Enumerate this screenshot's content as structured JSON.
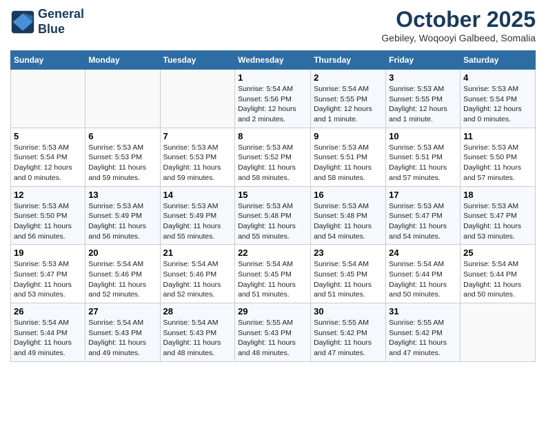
{
  "header": {
    "logo_line1": "General",
    "logo_line2": "Blue",
    "month": "October 2025",
    "location": "Gebiley, Woqooyi Galbeed, Somalia"
  },
  "weekdays": [
    "Sunday",
    "Monday",
    "Tuesday",
    "Wednesday",
    "Thursday",
    "Friday",
    "Saturday"
  ],
  "weeks": [
    [
      {
        "day": "",
        "info": ""
      },
      {
        "day": "",
        "info": ""
      },
      {
        "day": "",
        "info": ""
      },
      {
        "day": "1",
        "info": "Sunrise: 5:54 AM\nSunset: 5:56 PM\nDaylight: 12 hours and 2 minutes."
      },
      {
        "day": "2",
        "info": "Sunrise: 5:54 AM\nSunset: 5:55 PM\nDaylight: 12 hours and 1 minute."
      },
      {
        "day": "3",
        "info": "Sunrise: 5:53 AM\nSunset: 5:55 PM\nDaylight: 12 hours and 1 minute."
      },
      {
        "day": "4",
        "info": "Sunrise: 5:53 AM\nSunset: 5:54 PM\nDaylight: 12 hours and 0 minutes."
      }
    ],
    [
      {
        "day": "5",
        "info": "Sunrise: 5:53 AM\nSunset: 5:54 PM\nDaylight: 12 hours and 0 minutes."
      },
      {
        "day": "6",
        "info": "Sunrise: 5:53 AM\nSunset: 5:53 PM\nDaylight: 11 hours and 59 minutes."
      },
      {
        "day": "7",
        "info": "Sunrise: 5:53 AM\nSunset: 5:53 PM\nDaylight: 11 hours and 59 minutes."
      },
      {
        "day": "8",
        "info": "Sunrise: 5:53 AM\nSunset: 5:52 PM\nDaylight: 11 hours and 58 minutes."
      },
      {
        "day": "9",
        "info": "Sunrise: 5:53 AM\nSunset: 5:51 PM\nDaylight: 11 hours and 58 minutes."
      },
      {
        "day": "10",
        "info": "Sunrise: 5:53 AM\nSunset: 5:51 PM\nDaylight: 11 hours and 57 minutes."
      },
      {
        "day": "11",
        "info": "Sunrise: 5:53 AM\nSunset: 5:50 PM\nDaylight: 11 hours and 57 minutes."
      }
    ],
    [
      {
        "day": "12",
        "info": "Sunrise: 5:53 AM\nSunset: 5:50 PM\nDaylight: 11 hours and 56 minutes."
      },
      {
        "day": "13",
        "info": "Sunrise: 5:53 AM\nSunset: 5:49 PM\nDaylight: 11 hours and 56 minutes."
      },
      {
        "day": "14",
        "info": "Sunrise: 5:53 AM\nSunset: 5:49 PM\nDaylight: 11 hours and 55 minutes."
      },
      {
        "day": "15",
        "info": "Sunrise: 5:53 AM\nSunset: 5:48 PM\nDaylight: 11 hours and 55 minutes."
      },
      {
        "day": "16",
        "info": "Sunrise: 5:53 AM\nSunset: 5:48 PM\nDaylight: 11 hours and 54 minutes."
      },
      {
        "day": "17",
        "info": "Sunrise: 5:53 AM\nSunset: 5:47 PM\nDaylight: 11 hours and 54 minutes."
      },
      {
        "day": "18",
        "info": "Sunrise: 5:53 AM\nSunset: 5:47 PM\nDaylight: 11 hours and 53 minutes."
      }
    ],
    [
      {
        "day": "19",
        "info": "Sunrise: 5:53 AM\nSunset: 5:47 PM\nDaylight: 11 hours and 53 minutes."
      },
      {
        "day": "20",
        "info": "Sunrise: 5:54 AM\nSunset: 5:46 PM\nDaylight: 11 hours and 52 minutes."
      },
      {
        "day": "21",
        "info": "Sunrise: 5:54 AM\nSunset: 5:46 PM\nDaylight: 11 hours and 52 minutes."
      },
      {
        "day": "22",
        "info": "Sunrise: 5:54 AM\nSunset: 5:45 PM\nDaylight: 11 hours and 51 minutes."
      },
      {
        "day": "23",
        "info": "Sunrise: 5:54 AM\nSunset: 5:45 PM\nDaylight: 11 hours and 51 minutes."
      },
      {
        "day": "24",
        "info": "Sunrise: 5:54 AM\nSunset: 5:44 PM\nDaylight: 11 hours and 50 minutes."
      },
      {
        "day": "25",
        "info": "Sunrise: 5:54 AM\nSunset: 5:44 PM\nDaylight: 11 hours and 50 minutes."
      }
    ],
    [
      {
        "day": "26",
        "info": "Sunrise: 5:54 AM\nSunset: 5:44 PM\nDaylight: 11 hours and 49 minutes."
      },
      {
        "day": "27",
        "info": "Sunrise: 5:54 AM\nSunset: 5:43 PM\nDaylight: 11 hours and 49 minutes."
      },
      {
        "day": "28",
        "info": "Sunrise: 5:54 AM\nSunset: 5:43 PM\nDaylight: 11 hours and 48 minutes."
      },
      {
        "day": "29",
        "info": "Sunrise: 5:55 AM\nSunset: 5:43 PM\nDaylight: 11 hours and 48 minutes."
      },
      {
        "day": "30",
        "info": "Sunrise: 5:55 AM\nSunset: 5:42 PM\nDaylight: 11 hours and 47 minutes."
      },
      {
        "day": "31",
        "info": "Sunrise: 5:55 AM\nSunset: 5:42 PM\nDaylight: 11 hours and 47 minutes."
      },
      {
        "day": "",
        "info": ""
      }
    ]
  ]
}
